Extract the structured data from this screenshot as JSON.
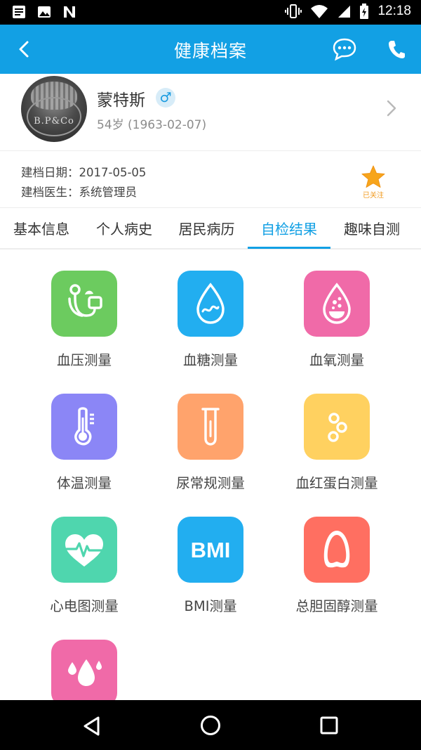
{
  "status_bar": {
    "time": "12:18"
  },
  "app_bar": {
    "title": "健康档案"
  },
  "profile": {
    "name": "蒙特斯",
    "gender_symbol": "♂",
    "age_line": "54岁 (1963-02-07)",
    "avatar_engraving": "B.P&Co"
  },
  "record": {
    "date_line": "建档日期：2017-05-05",
    "doctor_line": "建档医生：系统管理员",
    "follow_label": "已关注"
  },
  "tabs": [
    {
      "label": "基本信息"
    },
    {
      "label": "个人病史"
    },
    {
      "label": "居民病历"
    },
    {
      "label": "自检结果"
    },
    {
      "label": "趣味自测"
    }
  ],
  "active_tab": "自检结果",
  "tests": [
    {
      "label": "血压测量",
      "icon": "stethoscope-icon",
      "color": "#6CCB5F"
    },
    {
      "label": "血糖测量",
      "icon": "blood-drop-icon",
      "color": "#22AEF0"
    },
    {
      "label": "血氧测量",
      "icon": "oxygen-drop-icon",
      "color": "#F06AA8"
    },
    {
      "label": "体温测量",
      "icon": "thermometer-icon",
      "color": "#8B86F6"
    },
    {
      "label": "尿常规测量",
      "icon": "test-tube-icon",
      "color": "#FFA36C"
    },
    {
      "label": "血红蛋白测量",
      "icon": "hemoglobin-icon",
      "color": "#FFD160"
    },
    {
      "label": "心电图测量",
      "icon": "heart-ecg-icon",
      "color": "#4FD6AE"
    },
    {
      "label": "BMI测量",
      "icon": "bmi-icon",
      "color": "#22AEF0"
    },
    {
      "label": "总胆固醇测量",
      "icon": "cholesterol-icon",
      "color": "#FF6F61"
    },
    {
      "label": "",
      "icon": "drops-icon",
      "color": "#F06AA8"
    }
  ],
  "bmi_icon_text": "BMI",
  "colors": {
    "primary": "#12A0E4",
    "follow_star": "#F7A51C"
  }
}
